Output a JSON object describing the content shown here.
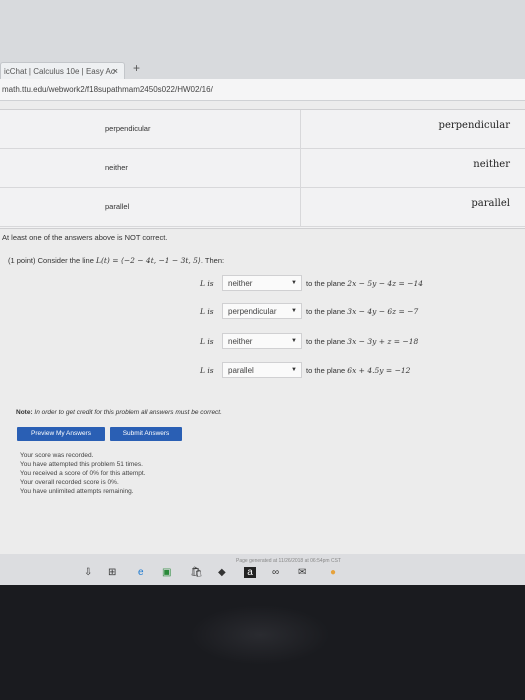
{
  "browser": {
    "tab_title": "icChat | Calculus 10e | Easy Ac",
    "tab_close": "×",
    "new_tab": "+",
    "url": "math.ttu.edu/webwork2/f18supathmam2450s022/HW02/16/"
  },
  "matching": {
    "left_items": [
      "perpendicular",
      "neither",
      "parallel"
    ],
    "right_items": [
      "perpendicular",
      "neither",
      "parallel"
    ]
  },
  "feedback": "At least one of the answers above is NOT correct.",
  "problem": {
    "points": "(1 point)",
    "intro": "Consider the line",
    "line_eq": "L(t) = ⟨−2 − 4t, −1 − 3t, 5⟩",
    "then": "Then:",
    "rows": [
      {
        "lis": "L is",
        "answer": "neither",
        "plane_text": "to the plane",
        "plane_eq": "2x − 5y − 4z = −14"
      },
      {
        "lis": "L is",
        "answer": "perpendicular",
        "plane_text": "to the plane",
        "plane_eq": "3x − 4y − 6z = −7"
      },
      {
        "lis": "L is",
        "answer": "neither",
        "plane_text": "to the plane",
        "plane_eq": "3x − 3y + z = −18"
      },
      {
        "lis": "L is",
        "answer": "parallel",
        "plane_text": "to the plane",
        "plane_eq": "6x + 4.5y = −12"
      }
    ]
  },
  "note": {
    "label": "Note:",
    "text": "In order to get credit for this problem all answers must be correct."
  },
  "buttons": {
    "preview": "Preview My Answers",
    "submit": "Submit Answers"
  },
  "result_lines": [
    "Your score was recorded.",
    "You have attempted this problem 51 times.",
    "You received a score of 0% for this attempt.",
    "Your overall recorded score is 0%.",
    "You have unlimited attempts remaining."
  ],
  "footer": "Page generated at 11/26/2018 at 06:54pm CST",
  "taskbar_icons": [
    "download-icon",
    "windows-grid-icon",
    "edge-icon",
    "photos-icon",
    "store-icon",
    "dropbox-icon",
    "amazon-icon",
    "flickr-icon",
    "mail-icon",
    "chrome-icon"
  ]
}
